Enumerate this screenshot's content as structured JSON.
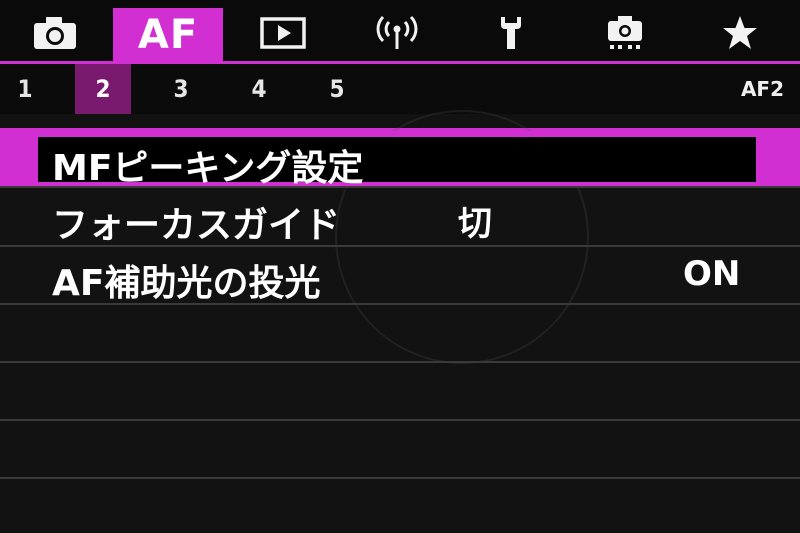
{
  "top_tabs": [
    {
      "id": "shooting",
      "icon": "camera-icon"
    },
    {
      "id": "af",
      "label": "AF",
      "active": true
    },
    {
      "id": "playback",
      "icon": "playback-icon"
    },
    {
      "id": "wireless",
      "icon": "wireless-icon"
    },
    {
      "id": "setup",
      "icon": "wrench-icon"
    },
    {
      "id": "custom",
      "icon": "custom-functions-icon"
    },
    {
      "id": "mymenu",
      "icon": "star-icon"
    }
  ],
  "sub_tabs": [
    "1",
    "2",
    "3",
    "4",
    "5"
  ],
  "active_sub_tab": "2",
  "page_code": "AF2",
  "menu": {
    "items": [
      {
        "label": "MFピーキング設定",
        "value": "",
        "selected": true
      },
      {
        "label": "フォーカスガイド",
        "value": "切"
      },
      {
        "label": "AF補助光の投光",
        "value": "ON"
      }
    ]
  },
  "colors": {
    "accent": "#d22fd2",
    "accent_dark": "#7a1a6f",
    "background": "#121212"
  }
}
